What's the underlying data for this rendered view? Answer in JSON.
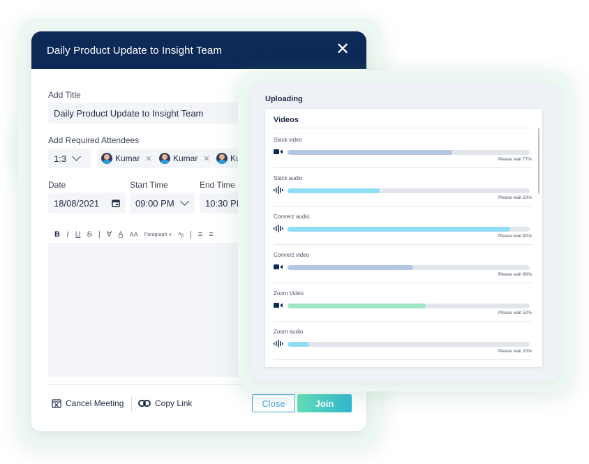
{
  "meeting_dialog": {
    "title": "Daily Product Update to Insight Team",
    "close_icon": "close-icon",
    "add_title_label": "Add Title",
    "title_value": "Daily Product Update to Insight Team",
    "attendees_label": "Add Required Attendees",
    "meeting_type": "1:3",
    "attendees": [
      "Kumar",
      "Kumar",
      "Ku"
    ],
    "date_label": "Date",
    "date_value": "18/08/2021",
    "start_label": "Start Time",
    "start_value": "09:00 PM",
    "end_label": "End Time",
    "end_value": "10:30 PM",
    "toolbar": {
      "bold": "B",
      "italic": "I",
      "underline": "U",
      "strike": "S",
      "paragraph": "Paragraph ∨",
      "font_size": "AA"
    },
    "cancel_label": "Cancel Meeting",
    "copy_link_label": "Copy Link",
    "close_button": "Close",
    "join_button": "Join",
    "colors": {
      "header": "#0d2957",
      "join_gradient": [
        "#61dfb6",
        "#2cb7d2"
      ],
      "close_border": "#4aa4e0"
    }
  },
  "uploading": {
    "title": "Uploading",
    "section": "Videos",
    "items": [
      {
        "name": "Slack video",
        "icon": "video-camera-icon",
        "progress": 0.68,
        "status": "Please wait 77%",
        "color": "#b3c6e3"
      },
      {
        "name": "Slack audio",
        "icon": "audio-wave-icon",
        "progress": 0.38,
        "status": "Please wait 50%",
        "color": "#8fdcf5"
      },
      {
        "name": "Converz audio",
        "icon": "audio-wave-icon",
        "progress": 0.92,
        "status": "Please wait 90%",
        "color": "#8fdcf5"
      },
      {
        "name": "Converz video",
        "icon": "video-camera-icon",
        "progress": 0.52,
        "status": "Please wait 68%",
        "color": "#b3c6e3"
      },
      {
        "name": "Zoom Video",
        "icon": "video-camera-icon",
        "progress": 0.57,
        "status": "Please wait 52%",
        "color": "#9ee6c4"
      },
      {
        "name": "Zoom audio",
        "icon": "audio-wave-icon",
        "progress": 0.09,
        "status": "Please wait 20%",
        "color": "#8fdcf5"
      }
    ]
  }
}
